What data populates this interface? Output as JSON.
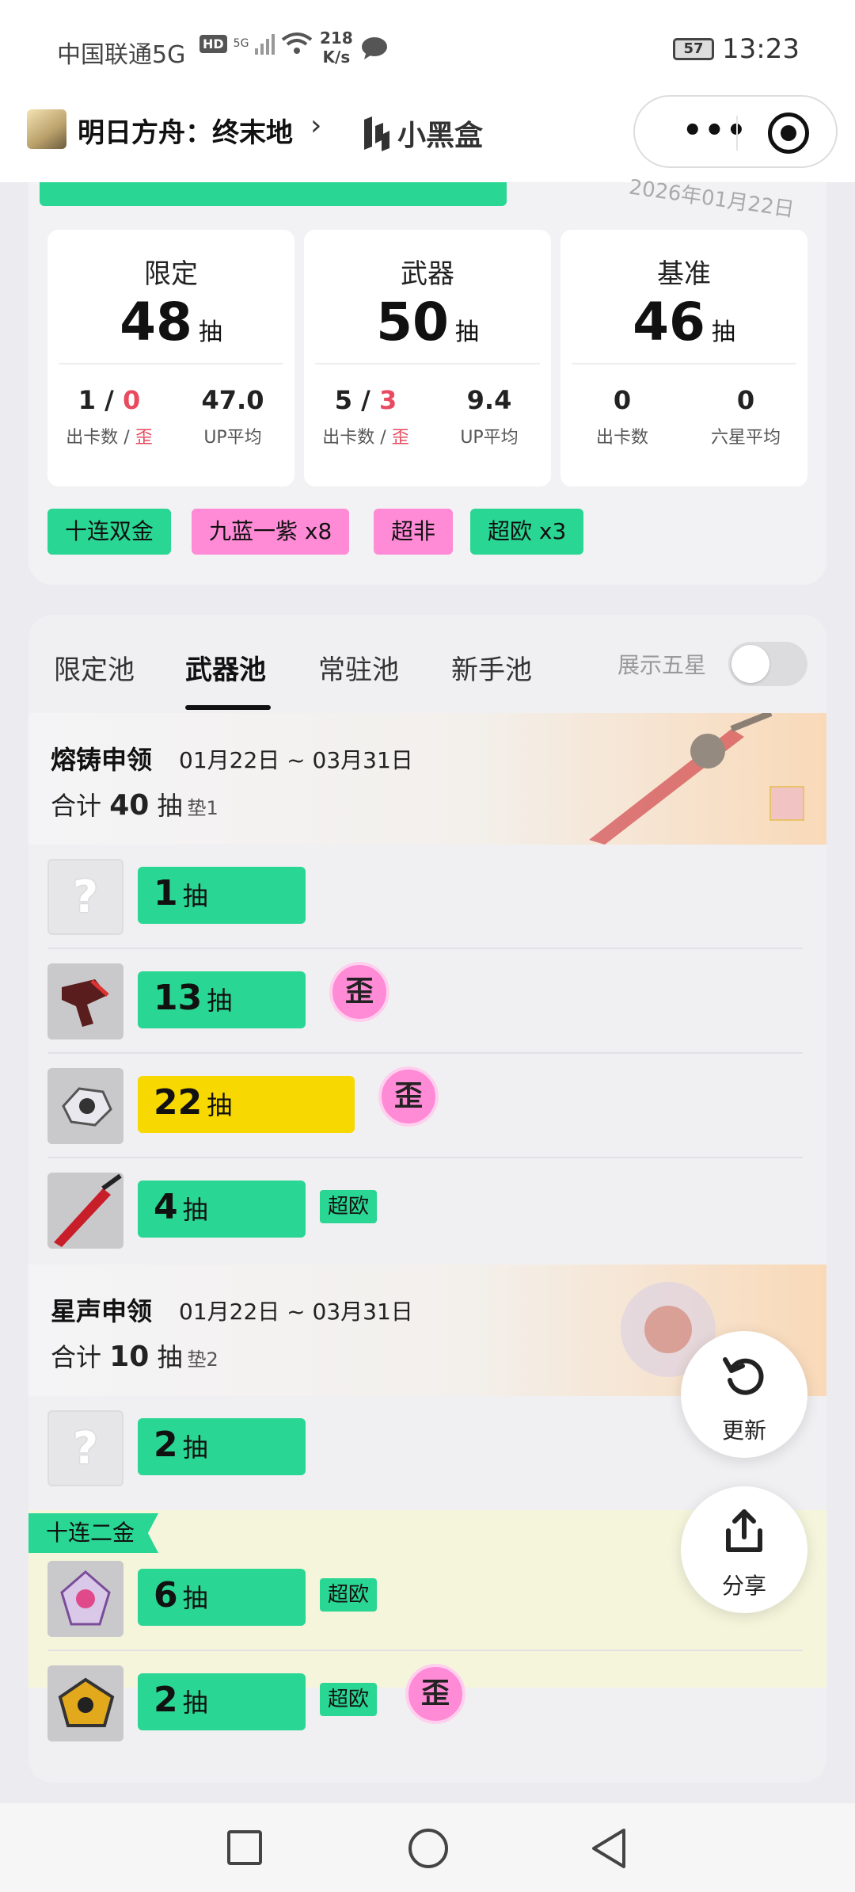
{
  "status_bar": {
    "carrier": "中国联通5G",
    "hd": "HD",
    "sig": "5G",
    "speed_value": "218",
    "speed_unit": "K/s",
    "battery": "57",
    "time": "13:23"
  },
  "header": {
    "game_title": "明日方舟：终末地",
    "chevron": "›",
    "brand": "小黑盒",
    "more": "•••"
  },
  "summary": {
    "stamp": "2026年01月22日",
    "stats": [
      {
        "label": "限定",
        "count": "48",
        "unit": "抽",
        "left_value_a": "1",
        "left_value_sep": " / ",
        "left_value_b": "0",
        "left_caption_a": "出卡数 / ",
        "left_caption_b": "歪",
        "right_value": "47.0",
        "right_caption": "UP平均"
      },
      {
        "label": "武器",
        "count": "50",
        "unit": "抽",
        "left_value_a": "5",
        "left_value_sep": " / ",
        "left_value_b": "3",
        "left_caption_a": "出卡数 / ",
        "left_caption_b": "歪",
        "right_value": "9.4",
        "right_caption": "UP平均"
      },
      {
        "label": "基准",
        "count": "46",
        "unit": "抽",
        "left_value_a": "0",
        "left_caption_a": "出卡数",
        "right_value": "0",
        "right_caption": "六星平均"
      }
    ],
    "tags": [
      "十连双金",
      "九蓝一紫 x8",
      "超非",
      "超欧 x3"
    ]
  },
  "pools": {
    "tabs": [
      "限定池",
      "武器池",
      "常驻池",
      "新手池"
    ],
    "active_tab": "武器池",
    "show_five_label": "展示五星",
    "show_five_enabled": false,
    "groups": [
      {
        "name": "熔铸申领",
        "date": "01月22日 ~ 03月31日",
        "total_prefix": "合计",
        "total": "40",
        "total_unit": "抽",
        "pity": "垫1",
        "rows": [
          {
            "count": "1",
            "unit": "抽",
            "known": false,
            "bar_color": "green"
          },
          {
            "count": "13",
            "unit": "抽",
            "known": true,
            "bar_color": "green",
            "wai": "歪"
          },
          {
            "count": "22",
            "unit": "抽",
            "known": true,
            "bar_color": "yellow",
            "wai": "歪"
          },
          {
            "count": "4",
            "unit": "抽",
            "known": true,
            "bar_color": "green",
            "lucky": "超欧"
          }
        ]
      },
      {
        "name": "星声申领",
        "date": "01月22日 ~ 03月31日",
        "total_prefix": "合计",
        "total": "10",
        "total_unit": "抽",
        "pity": "垫2",
        "ten_badge": "十连二金",
        "rows": [
          {
            "count": "2",
            "unit": "抽",
            "known": false,
            "bar_color": "green"
          },
          {
            "count": "6",
            "unit": "抽",
            "known": true,
            "bar_color": "green",
            "lucky": "超欧"
          },
          {
            "count": "2",
            "unit": "抽",
            "known": true,
            "bar_color": "green",
            "lucky": "超欧",
            "wai": "歪"
          }
        ]
      }
    ]
  },
  "fab": {
    "refresh": "更新",
    "share": "分享"
  },
  "unknown_mark": "?",
  "colors": {
    "accent_green": "#29d693",
    "pink": "#ff8ad6",
    "yellow": "#f7d800",
    "red_text": "#e84a5f"
  },
  "icons": {
    "refresh": "refresh-icon",
    "share": "share-icon",
    "more": "more-dots-icon",
    "close_miniprogram": "target-icon"
  }
}
